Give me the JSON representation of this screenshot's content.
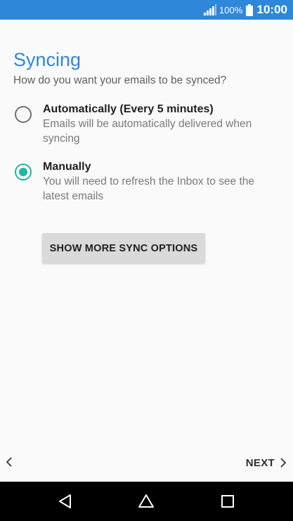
{
  "status_bar": {
    "battery_percent": "100%",
    "time": "10:00",
    "icons": [
      "signal-icon",
      "battery-icon"
    ],
    "color": "#2f87d9"
  },
  "header": {
    "title": "Syncing",
    "subtitle": "How do you want your emails to be synced?"
  },
  "sync_options": [
    {
      "title": "Automatically (Every 5 minutes)",
      "description": "Emails will be automatically delivered when syncing",
      "selected": false
    },
    {
      "title": "Manually",
      "description": "You will need to refresh the Inbox to see the latest emails",
      "selected": true
    }
  ],
  "more_options_button": "SHOW MORE SYNC OPTIONS",
  "footer": {
    "next_label": "NEXT",
    "icons": [
      "chevron-left-icon",
      "chevron-right-icon"
    ]
  },
  "nav_bar": {
    "icons": [
      "back-icon",
      "home-icon",
      "recents-icon"
    ]
  },
  "colors": {
    "accent": "#2f87d9",
    "radio_selected": "#1fb6a4",
    "button_bg": "#dadada"
  }
}
